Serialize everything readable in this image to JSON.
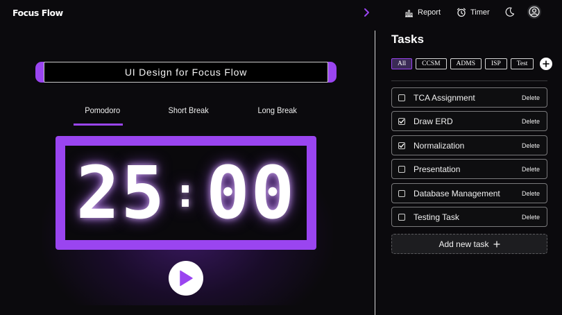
{
  "app": {
    "brand": "Focus Flow"
  },
  "nav": {
    "report_label": "Report",
    "timer_label": "Timer"
  },
  "session": {
    "title": "UI Design for Focus Flow"
  },
  "tabs": [
    {
      "label": "Pomodoro",
      "active": true
    },
    {
      "label": "Short Break",
      "active": false
    },
    {
      "label": "Long Break",
      "active": false
    }
  ],
  "timer": {
    "minutes": "25",
    "separator": ":",
    "seconds": "00"
  },
  "tasks_panel": {
    "title": "Tasks",
    "filters": [
      {
        "label": "All",
        "active": true
      },
      {
        "label": "CCSM",
        "active": false
      },
      {
        "label": "ADMS",
        "active": false
      },
      {
        "label": "ISP",
        "active": false
      },
      {
        "label": "Test",
        "active": false
      }
    ],
    "delete_label": "Delete",
    "tasks": [
      {
        "label": "TCA Assignment",
        "done": false
      },
      {
        "label": "Draw ERD",
        "done": true
      },
      {
        "label": "Normalization",
        "done": true
      },
      {
        "label": "Presentation",
        "done": false
      },
      {
        "label": "Database Management",
        "done": false
      },
      {
        "label": "Testing Task",
        "done": false
      }
    ],
    "add_task_label": "Add new task"
  },
  "icons": {
    "collapse": "chevron-right-icon",
    "report": "bar-chart-icon",
    "timer": "alarm-clock-icon",
    "theme": "moon-icon",
    "profile": "user-circle-icon",
    "play": "play-icon",
    "add": "plus-icon"
  },
  "colors": {
    "accent": "#9a45f0",
    "background": "#0b0a0d",
    "panel": "#0e0e10"
  }
}
